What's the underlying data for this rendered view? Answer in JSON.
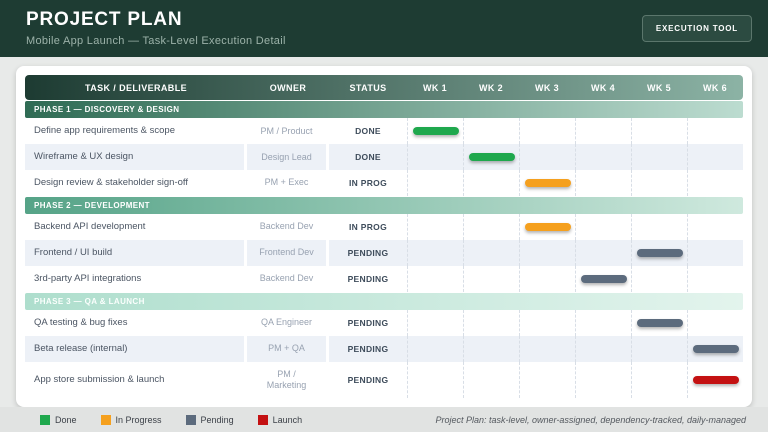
{
  "header": {
    "title": "PROJECT PLAN",
    "subtitle": "Mobile App Launch  —  Task-Level Execution Detail",
    "button_label": "EXECUTION TOOL"
  },
  "colors": {
    "done": "#1fa84d",
    "in_progress": "#f5a01e",
    "pending": "#5c6b7d",
    "launch": "#c41112",
    "header_dark_green": "#1e3c33",
    "phase1_green": "#2f6b54",
    "phase2_green": "#55a387",
    "phase3_mint": "#aedecd"
  },
  "table": {
    "columns": [
      "TASK / DELIVERABLE",
      "OWNER",
      "STATUS",
      "WK 1",
      "WK 2",
      "WK 3",
      "WK 4",
      "WK 5",
      "WK 6"
    ],
    "phases": [
      {
        "label": "PHASE 1 — DISCOVERY & DESIGN",
        "tasks": [
          {
            "task": "Define app requirements & scope",
            "owner": "PM / Product",
            "status": "DONE",
            "bar": {
              "week": 1,
              "type": "done"
            }
          },
          {
            "task": "Wireframe & UX design",
            "owner": "Design Lead",
            "status": "DONE",
            "bar": {
              "week": 2,
              "type": "done"
            }
          },
          {
            "task": "Design review & stakeholder sign-off",
            "owner": "PM + Exec",
            "status": "IN PROG",
            "bar": {
              "week": 3,
              "type": "in_progress"
            }
          }
        ]
      },
      {
        "label": "PHASE 2 — DEVELOPMENT",
        "tasks": [
          {
            "task": "Backend API development",
            "owner": "Backend Dev",
            "status": "IN PROG",
            "bar": {
              "week": 3,
              "type": "in_progress"
            }
          },
          {
            "task": "Frontend / UI build",
            "owner": "Frontend Dev",
            "status": "PENDING",
            "bar": {
              "week": 5,
              "type": "pending"
            }
          },
          {
            "task": "3rd-party API integrations",
            "owner": "Backend Dev",
            "status": "PENDING",
            "bar": {
              "week": 4,
              "type": "pending"
            }
          }
        ]
      },
      {
        "label": "PHASE 3 — QA & LAUNCH",
        "tasks": [
          {
            "task": "QA testing & bug fixes",
            "owner": "QA Engineer",
            "status": "PENDING",
            "bar": {
              "week": 5,
              "type": "pending"
            }
          },
          {
            "task": "Beta release (internal)",
            "owner": "PM + QA",
            "status": "PENDING",
            "bar": {
              "week": 6,
              "type": "pending"
            }
          },
          {
            "task": "App store submission & launch",
            "owner": "PM /\nMarketing",
            "status": "PENDING",
            "bar": {
              "week": 6,
              "type": "launch"
            }
          }
        ]
      }
    ]
  },
  "legend": {
    "items": [
      {
        "label": "Done",
        "type": "done"
      },
      {
        "label": "In Progress",
        "type": "in_progress"
      },
      {
        "label": "Pending",
        "type": "pending"
      },
      {
        "label": "Launch",
        "type": "launch"
      }
    ]
  },
  "footer": {
    "note": "Project Plan: task-level, owner-assigned, dependency-tracked, daily-managed"
  },
  "chart_data": {
    "type": "table",
    "title": "PROJECT PLAN — Mobile App Launch — Task-Level Execution Detail",
    "columns": [
      "TASK / DELIVERABLE",
      "OWNER",
      "STATUS",
      "WK 1",
      "WK 2",
      "WK 3",
      "WK 4",
      "WK 5",
      "WK 6"
    ],
    "x": [
      "WK 1",
      "WK 2",
      "WK 3",
      "WK 4",
      "WK 5",
      "WK 6"
    ],
    "rows": [
      {
        "phase": "PHASE 1 — DISCOVERY & DESIGN",
        "task": "Define app requirements & scope",
        "owner": "PM / Product",
        "status": "DONE",
        "bar_week": 1,
        "bar_category": "Done"
      },
      {
        "phase": "PHASE 1 — DISCOVERY & DESIGN",
        "task": "Wireframe & UX design",
        "owner": "Design Lead",
        "status": "DONE",
        "bar_week": 2,
        "bar_category": "Done"
      },
      {
        "phase": "PHASE 1 — DISCOVERY & DESIGN",
        "task": "Design review & stakeholder sign-off",
        "owner": "PM + Exec",
        "status": "IN PROG",
        "bar_week": 3,
        "bar_category": "In Progress"
      },
      {
        "phase": "PHASE 2 — DEVELOPMENT",
        "task": "Backend API development",
        "owner": "Backend Dev",
        "status": "IN PROG",
        "bar_week": 3,
        "bar_category": "In Progress"
      },
      {
        "phase": "PHASE 2 — DEVELOPMENT",
        "task": "Frontend / UI build",
        "owner": "Frontend Dev",
        "status": "PENDING",
        "bar_week": 5,
        "bar_category": "Pending"
      },
      {
        "phase": "PHASE 2 — DEVELOPMENT",
        "task": "3rd-party API integrations",
        "owner": "Backend Dev",
        "status": "PENDING",
        "bar_week": 4,
        "bar_category": "Pending"
      },
      {
        "phase": "PHASE 3 — QA & LAUNCH",
        "task": "QA testing & bug fixes",
        "owner": "QA Engineer",
        "status": "PENDING",
        "bar_week": 5,
        "bar_category": "Pending"
      },
      {
        "phase": "PHASE 3 — QA & LAUNCH",
        "task": "Beta release (internal)",
        "owner": "PM + QA",
        "status": "PENDING",
        "bar_week": 6,
        "bar_category": "Pending"
      },
      {
        "phase": "PHASE 3 — QA & LAUNCH",
        "task": "App store submission & launch",
        "owner": "PM / Marketing",
        "status": "PENDING",
        "bar_week": 6,
        "bar_category": "Launch"
      }
    ],
    "legend": [
      "Done",
      "In Progress",
      "Pending",
      "Launch"
    ],
    "legend_position": "bottom-left"
  }
}
